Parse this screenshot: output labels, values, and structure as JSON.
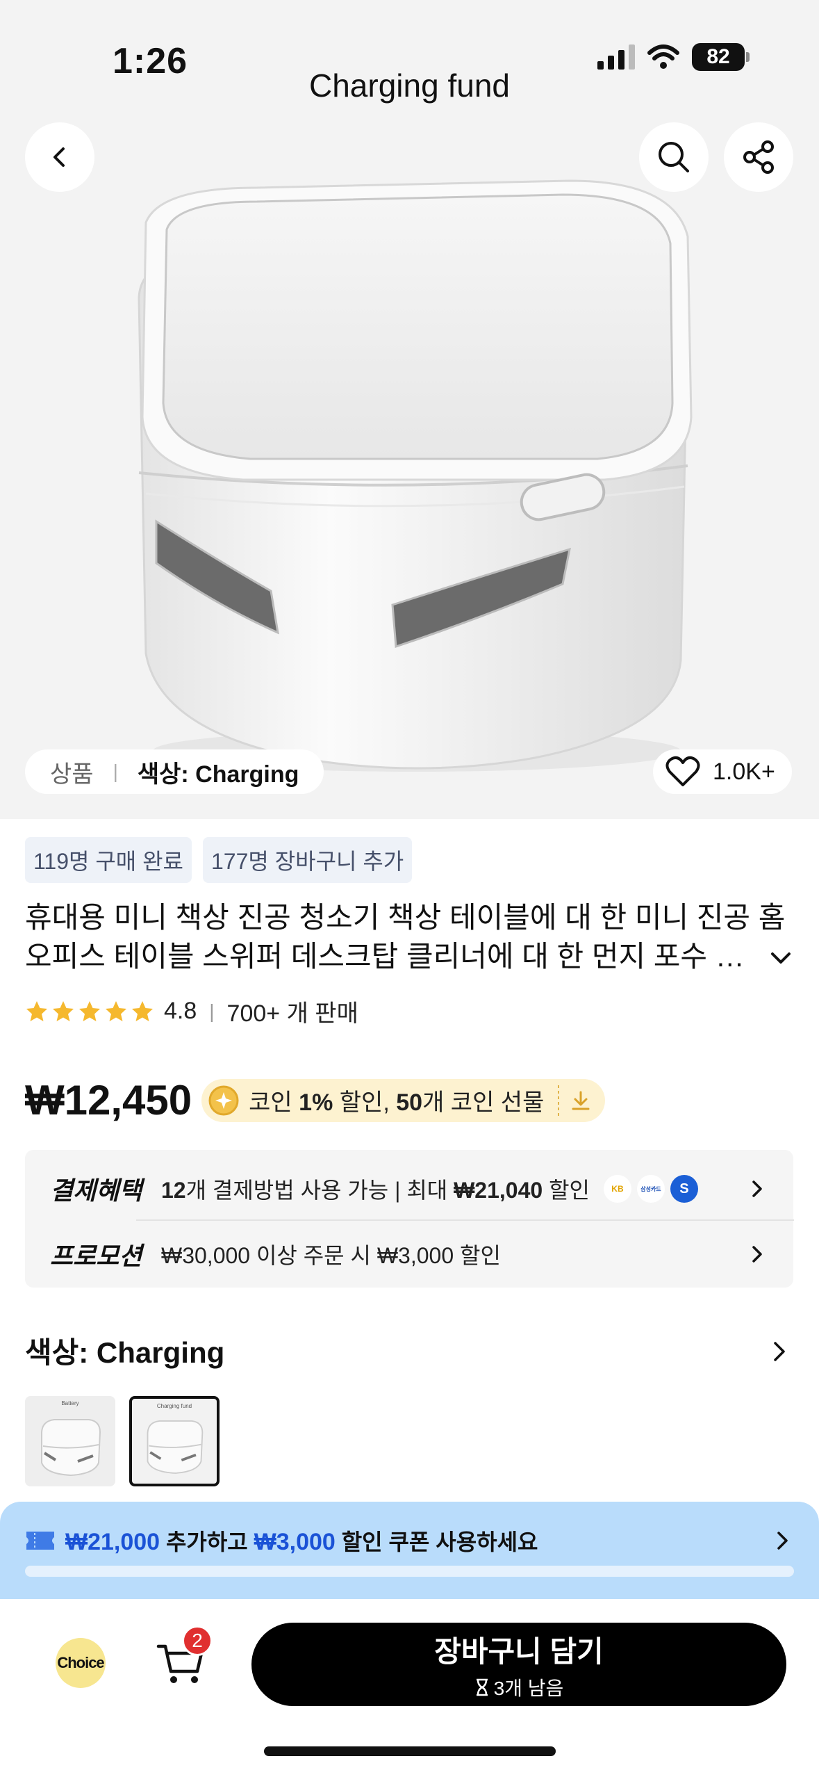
{
  "status_bar": {
    "time": "1:26",
    "battery": "82"
  },
  "header": {
    "title": "Charging fund"
  },
  "variant_pill": {
    "label": "상품",
    "value": "색상: Charging"
  },
  "favorites": {
    "count": "1.0K+"
  },
  "tags": [
    "119명 구매 완료",
    "177명 장바구니 추가"
  ],
  "product": {
    "title_line1": "휴대용 미니 책상 진공 청소기 책상 테이블에 대 한 미니 진공 홈",
    "title_line2": "오피스 테이블 스위퍼 데스크탑 클리너에 대 한 먼지 포수 자동",
    "rating": "4.8",
    "stars": 5,
    "sold": "700+ 개 판매",
    "price": "₩12,450",
    "coin_text_1": "코인",
    "coin_percent": "1%",
    "coin_text_2": "할인,",
    "coin_count": "50",
    "coin_text_3": "개 코인 선물"
  },
  "benefits": {
    "payment_head": "결제혜택",
    "payment_count": "12",
    "payment_text": "개 결제방법 사용 가능 | 최대",
    "payment_amount": "₩21,040",
    "payment_suffix": "할인",
    "cards": [
      "KB",
      "삼성카드",
      "S"
    ],
    "promo_head": "프로모션",
    "promo_text": "₩30,000 이상 주문 시 ₩3,000 할인"
  },
  "color_section": {
    "heading": "색상: Charging",
    "thumbs": [
      {
        "label": "Battery",
        "selected": false
      },
      {
        "label": "Charging fund",
        "selected": true
      }
    ]
  },
  "coupon": {
    "amount1": "₩21,000",
    "text1": "추가하고",
    "amount2": "₩3,000",
    "text2": "할인 쿠폰 사용하세요"
  },
  "bottom_bar": {
    "choice_label": "Choice",
    "cart_count": "2",
    "add_to_cart": "장바구니 담기",
    "stock_note": "3개 남음"
  },
  "colors": {
    "hero_bg": "#f3f3f3",
    "coupon_bg": "#b9dcfb",
    "coupon_blue": "#1a52d6",
    "star": "#f5b82e",
    "badge_red": "#e02f2f",
    "button_black": "#000000"
  }
}
